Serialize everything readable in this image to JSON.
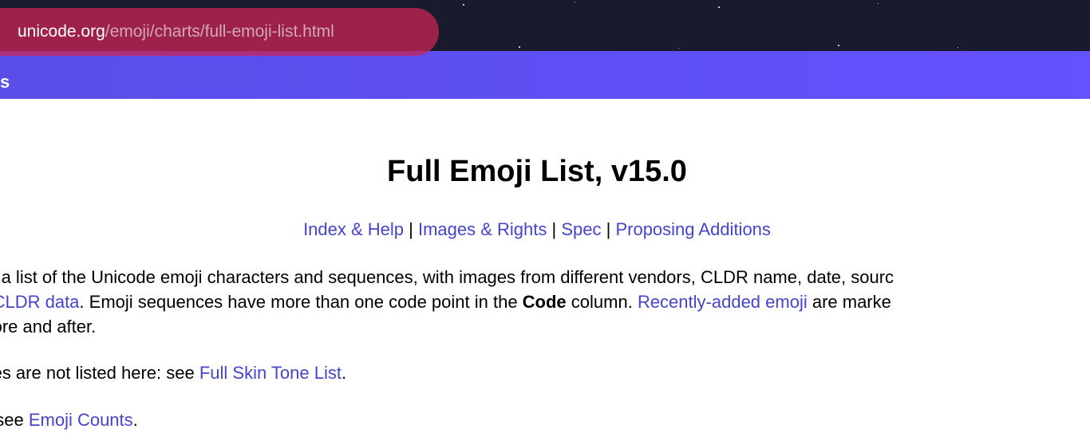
{
  "url": {
    "domain": "unicode.org",
    "path": "/emoji/charts/full-emoji-list.html"
  },
  "navbar": {
    "visible_fragment": "s"
  },
  "page": {
    "title": "Full Emoji List, v15.0",
    "nav_links": {
      "index_help": "Index & Help",
      "images_rights": "Images & Rights",
      "spec": "Spec",
      "proposing_additions": "Proposing Additions",
      "sep": " | "
    },
    "paragraph1": {
      "part1": "des a list of the Unicode emoji characters and sequences, with images from different vendors, CLDR name, date, sourc",
      "link1": "de CLDR data",
      "part2": ". Emoji sequences have more than one code point in the ",
      "bold1": "Code",
      "part3": " column. ",
      "link2": "Recently-added emoji",
      "part4": " are marke",
      "part5": "before and after."
    },
    "paragraph2": {
      "part1": "tones are not listed here: see ",
      "link1": "Full Skin Tone List",
      "part2": "."
    },
    "paragraph3": {
      "part1": "oji, see ",
      "link1": "Emoji Counts",
      "part2": "."
    }
  }
}
